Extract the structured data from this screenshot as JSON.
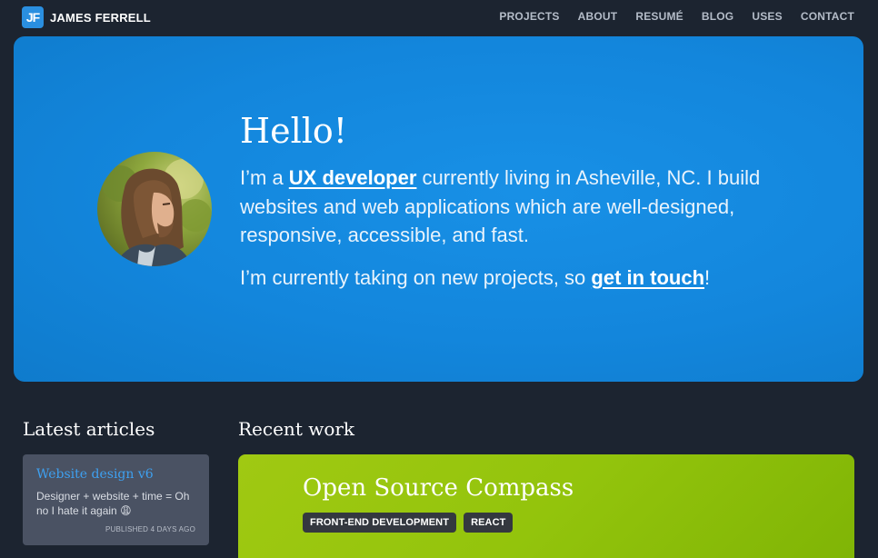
{
  "header": {
    "logo_mark": "JF",
    "logo_text": "JAMES FERRELL",
    "nav": [
      "PROJECTS",
      "ABOUT",
      "RESUMÉ",
      "BLOG",
      "USES",
      "CONTACT"
    ]
  },
  "hero": {
    "greeting": "Hello!",
    "line1_pre": "I’m a ",
    "line1_link": "UX developer",
    "line1_post": " currently living in Asheville, NC. I build websites and web applications which are well-designed, responsive, accessible, and fast.",
    "line2_pre": "I’m currently taking on new projects, so ",
    "line2_link": "get in touch",
    "line2_post": "!"
  },
  "articles": {
    "heading": "Latest articles",
    "items": [
      {
        "title": "Website design v6",
        "description": "Designer + website + time = Oh no I hate it again 😩",
        "meta": "PUBLISHED 4 DAYS AGO"
      }
    ]
  },
  "work": {
    "heading": "Recent work",
    "items": [
      {
        "title": "Open Source Compass",
        "tags": [
          "FRONT-END DEVELOPMENT",
          "REACT"
        ]
      }
    ]
  },
  "colors": {
    "background": "#1c2430",
    "hero_blue": "#1386dc",
    "work_green": "#93c40c",
    "article_card": "#4a5263",
    "link_blue": "#3ea0f0"
  }
}
